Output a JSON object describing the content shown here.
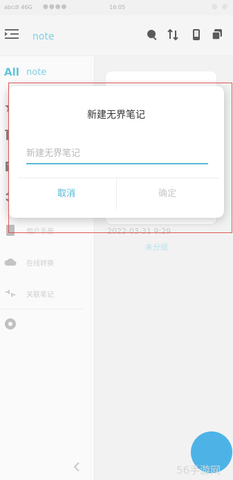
{
  "status_bar": {
    "left_text": "abcdl 46G",
    "time": "16:05",
    "right_icons": "◎ ◎"
  },
  "header": {
    "title": "note",
    "icons": [
      "menu-icon",
      "search-icon",
      "sort-icon",
      "phone-icon",
      "copy-icon"
    ]
  },
  "sidebar": {
    "all_label": "All",
    "note_label": "note",
    "items": [
      {
        "icon": "star-icon",
        "label": ""
      },
      {
        "icon": "trash-icon",
        "label": ""
      },
      {
        "icon": "folder-icon",
        "label": ""
      },
      {
        "icon": "share-icon",
        "label": ""
      },
      {
        "icon": "book-icon",
        "label": "用户手册"
      },
      {
        "icon": "cloud-icon",
        "label": "在线转换"
      },
      {
        "icon": "link-icon",
        "label": "关联笔记"
      },
      {
        "icon": "settings-icon",
        "label": ""
      }
    ]
  },
  "content": {
    "date": "2022-03-31 9:29",
    "tag": "未分组"
  },
  "dialog": {
    "title": "新建无界笔记",
    "input_placeholder": "新建无界笔记",
    "input_value": "",
    "cancel_label": "取消",
    "ok_label": "确定"
  },
  "watermark": "56手游网",
  "colors": {
    "accent": "#56b8d6",
    "highlight_border": "#e05555",
    "fab": "#4db3e6"
  }
}
